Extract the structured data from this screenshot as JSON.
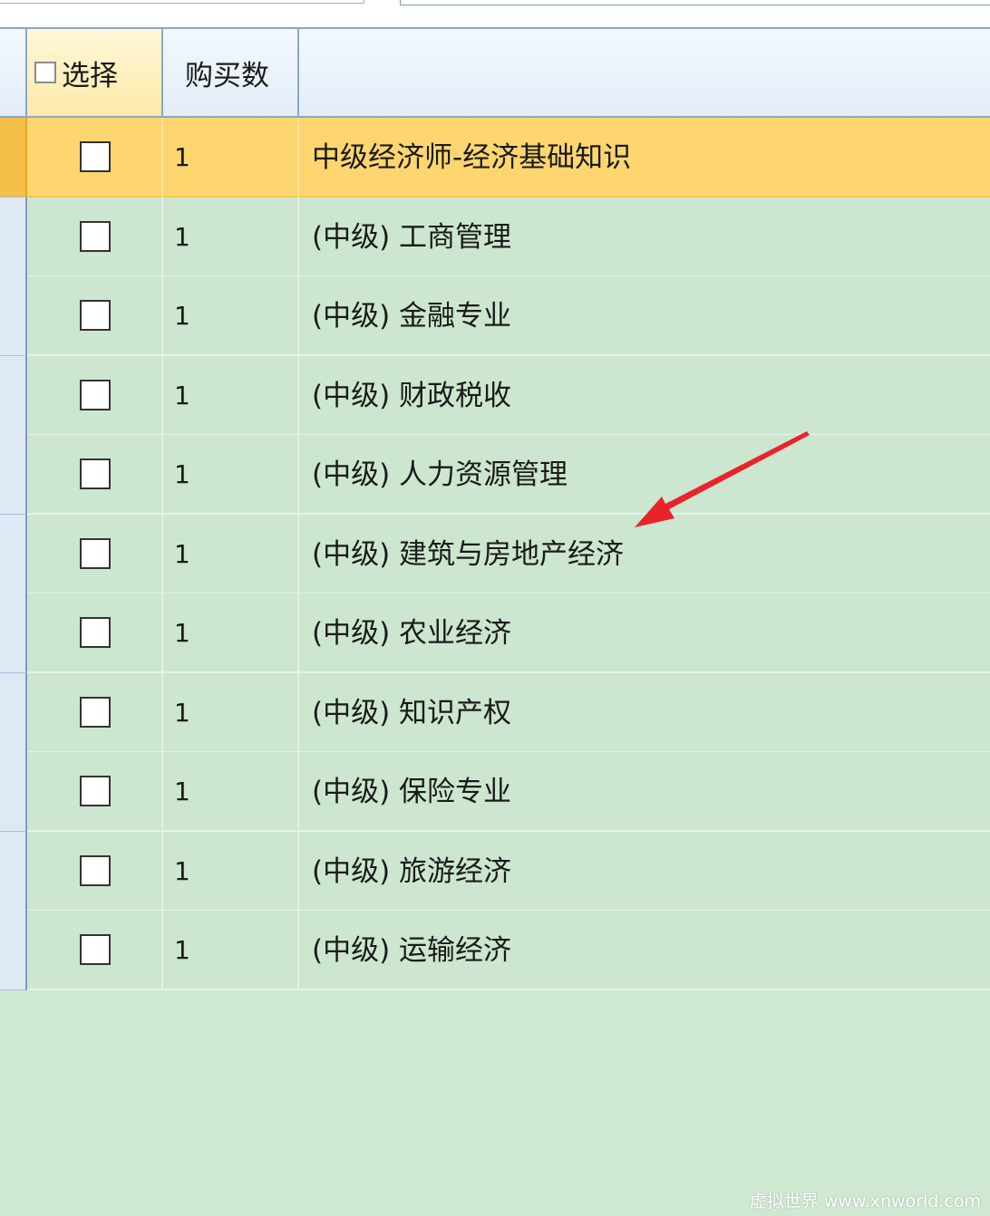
{
  "header": {
    "select_label": "选择",
    "qty_label": "购买数"
  },
  "rows": [
    {
      "qty": "1",
      "name": "中级经济师-经济基础知识",
      "selected": true
    },
    {
      "qty": "1",
      "name": "(中级) 工商管理"
    },
    {
      "qty": "1",
      "name": "(中级) 金融专业"
    },
    {
      "qty": "1",
      "name": "(中级) 财政税收"
    },
    {
      "qty": "1",
      "name": "(中级) 人力资源管理"
    },
    {
      "qty": "1",
      "name": "(中级) 建筑与房地产经济"
    },
    {
      "qty": "1",
      "name": "(中级) 农业经济"
    },
    {
      "qty": "1",
      "name": "(中级) 知识产权"
    },
    {
      "qty": "1",
      "name": "(中级) 保险专业"
    },
    {
      "qty": "1",
      "name": "(中级) 旅游经济"
    },
    {
      "qty": "1",
      "name": "(中级) 运输经济"
    }
  ],
  "colors": {
    "selected_row": "#fdd66f",
    "row_background": "#cce6cf",
    "grid_line": "#8aa7cc",
    "arrow": "#e8242a"
  },
  "annotation_icon": "red-arrow-icon",
  "watermark": "虚拟世界 www.xnworld.com"
}
